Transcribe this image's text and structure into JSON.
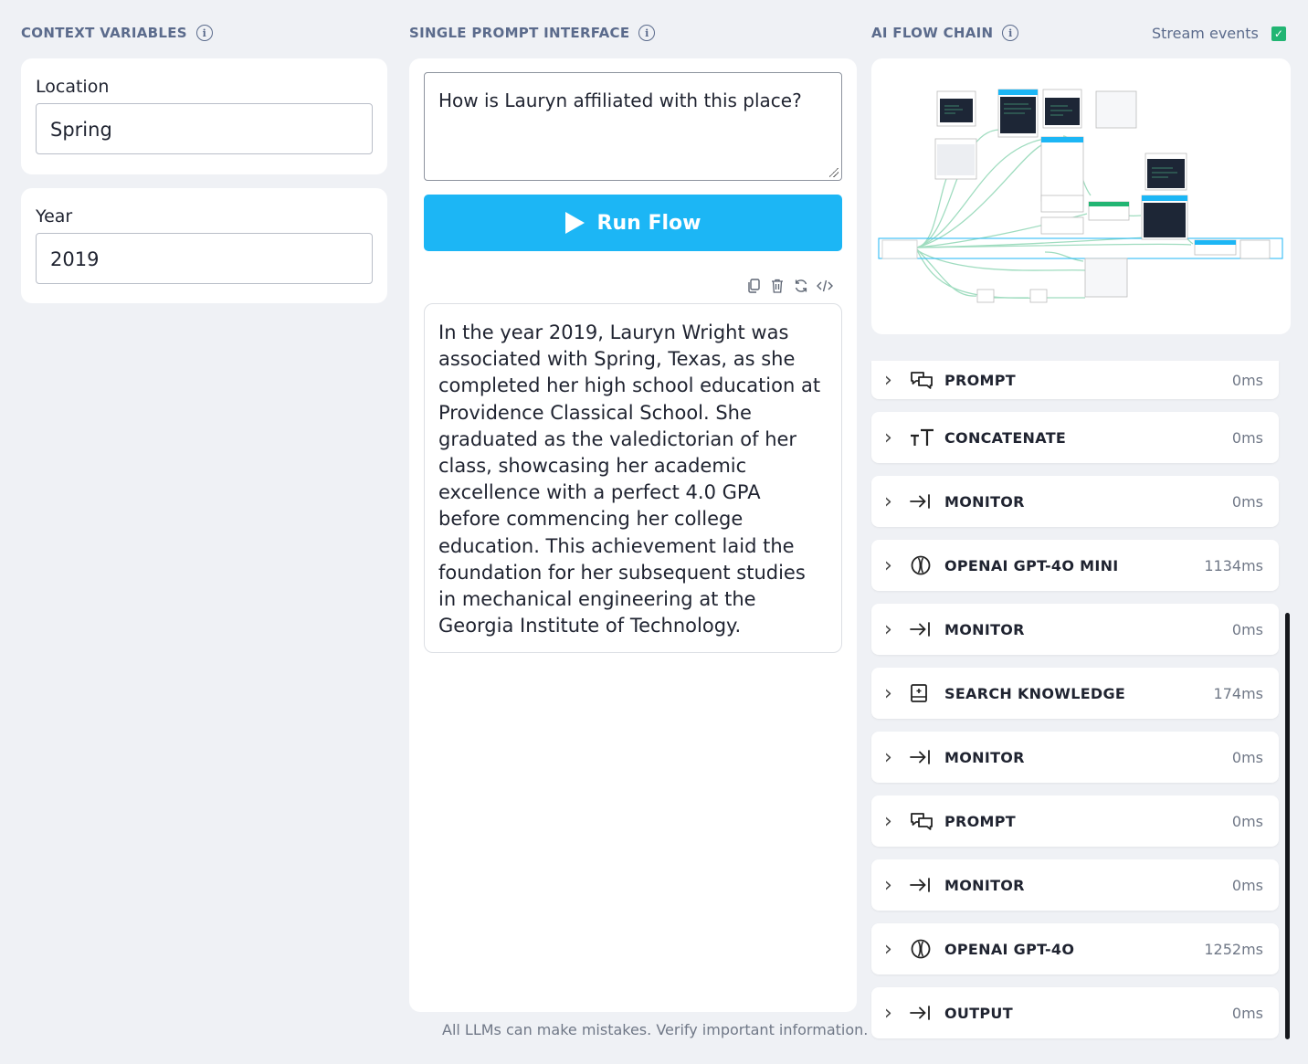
{
  "context": {
    "title": "CONTEXT VARIABLES",
    "variables": [
      {
        "label": "Location",
        "value": "Spring"
      },
      {
        "label": "Year",
        "value": "2019"
      }
    ]
  },
  "prompt": {
    "title": "SINGLE PROMPT INTERFACE",
    "question": "How is Lauryn affiliated with this place?",
    "run_label": "Run Flow",
    "response": "In the year 2019, Lauryn Wright was associated with Spring, Texas, as she completed her high school education at Providence Classical School. She graduated as the valedictorian of her class, showcasing her academic excellence with a perfect 4.0 GPA before commencing her college education. This achievement laid the foundation for her subsequent studies in mechanical engineering at the Georgia Institute of Technology.",
    "disclaimer": "All LLMs can make mistakes. Verify important information.",
    "tools": [
      "copy-icon",
      "trash-icon",
      "refresh-icon",
      "code-icon"
    ]
  },
  "flow": {
    "title": "AI FLOW CHAIN",
    "stream_label": "Stream events",
    "stream_checked": true,
    "accent": "#1cb6f5",
    "steps": [
      {
        "name": "PROMPT",
        "time": "0ms",
        "icon": "chat-bubbles-icon"
      },
      {
        "name": "CONCATENATE",
        "time": "0ms",
        "icon": "text-size-icon"
      },
      {
        "name": "MONITOR",
        "time": "0ms",
        "icon": "arrow-to-line-icon"
      },
      {
        "name": "OPENAI GPT-4O MINI",
        "time": "1134ms",
        "icon": "openai-icon"
      },
      {
        "name": "MONITOR",
        "time": "0ms",
        "icon": "arrow-to-line-icon"
      },
      {
        "name": "SEARCH KNOWLEDGE",
        "time": "174ms",
        "icon": "knowledge-book-icon"
      },
      {
        "name": "MONITOR",
        "time": "0ms",
        "icon": "arrow-to-line-icon"
      },
      {
        "name": "PROMPT",
        "time": "0ms",
        "icon": "chat-bubbles-icon"
      },
      {
        "name": "MONITOR",
        "time": "0ms",
        "icon": "arrow-to-line-icon"
      },
      {
        "name": "OPENAI GPT-4O",
        "time": "1252ms",
        "icon": "openai-icon"
      },
      {
        "name": "OUTPUT",
        "time": "0ms",
        "icon": "arrow-to-line-icon"
      }
    ]
  }
}
